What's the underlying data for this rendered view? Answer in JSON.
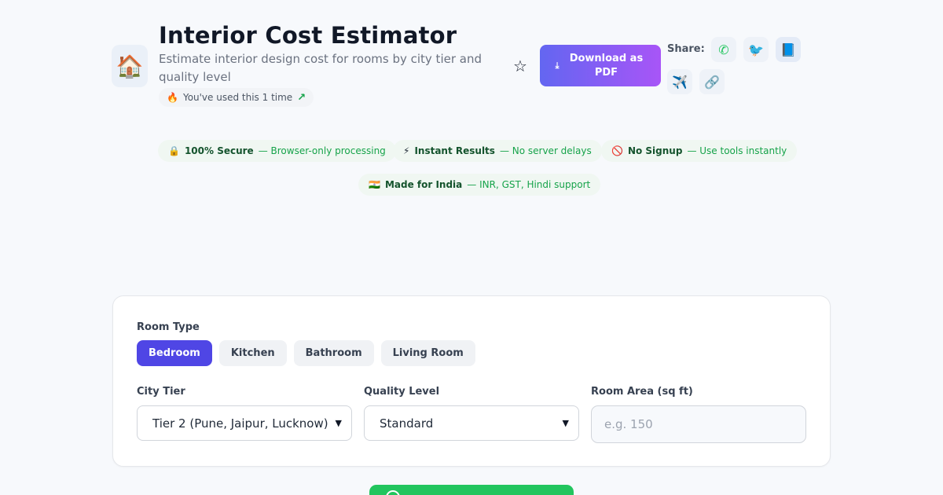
{
  "header": {
    "app_icon": "house-emoji",
    "app_icon_glyph": "🏠",
    "title": "Interior Cost Estimator",
    "subtitle": "Estimate interior design cost for rooms by city tier and quality level",
    "usage_text": "You've used this 1 time",
    "download_label": "Download as PDF",
    "share_label": "Share:"
  },
  "share_buttons": [
    {
      "name": "whatsapp-icon",
      "glyph": "✆"
    },
    {
      "name": "twitter-icon",
      "glyph": "🐦"
    },
    {
      "name": "facebook-icon",
      "glyph": "📘"
    },
    {
      "name": "telegram-icon",
      "glyph": "✈️"
    },
    {
      "name": "link-icon",
      "glyph": "🔗"
    }
  ],
  "badges": [
    {
      "icon": "🔒",
      "title": "100% Secure",
      "desc": "— Browser-only processing"
    },
    {
      "icon": "⚡",
      "title": "Instant Results",
      "desc": "— No server delays"
    },
    {
      "icon": "🚫",
      "title": "No Signup",
      "desc": "— Use tools instantly"
    },
    {
      "icon": "🇮🇳",
      "title": "Made for India",
      "desc": "— INR, GST, Hindi support"
    }
  ],
  "form": {
    "room_type_label": "Room Type",
    "room_types": [
      "Bedroom",
      "Kitchen",
      "Bathroom",
      "Living Room"
    ],
    "selected_room_type": "Bedroom",
    "city_tier_label": "City Tier",
    "city_tier_value": "Tier 2 (Pune, Jaipur, Lucknow)",
    "quality_label": "Quality Level",
    "quality_value": "Standard",
    "area_label": "Room Area (sq ft)",
    "area_placeholder": "e.g. 150",
    "area_value": ""
  },
  "colors": {
    "primary": "#4f46e5",
    "download_gradient_start": "#6366f1",
    "download_gradient_end": "#a855f7",
    "success": "#22c55e",
    "badge_text": "#16a34a"
  }
}
